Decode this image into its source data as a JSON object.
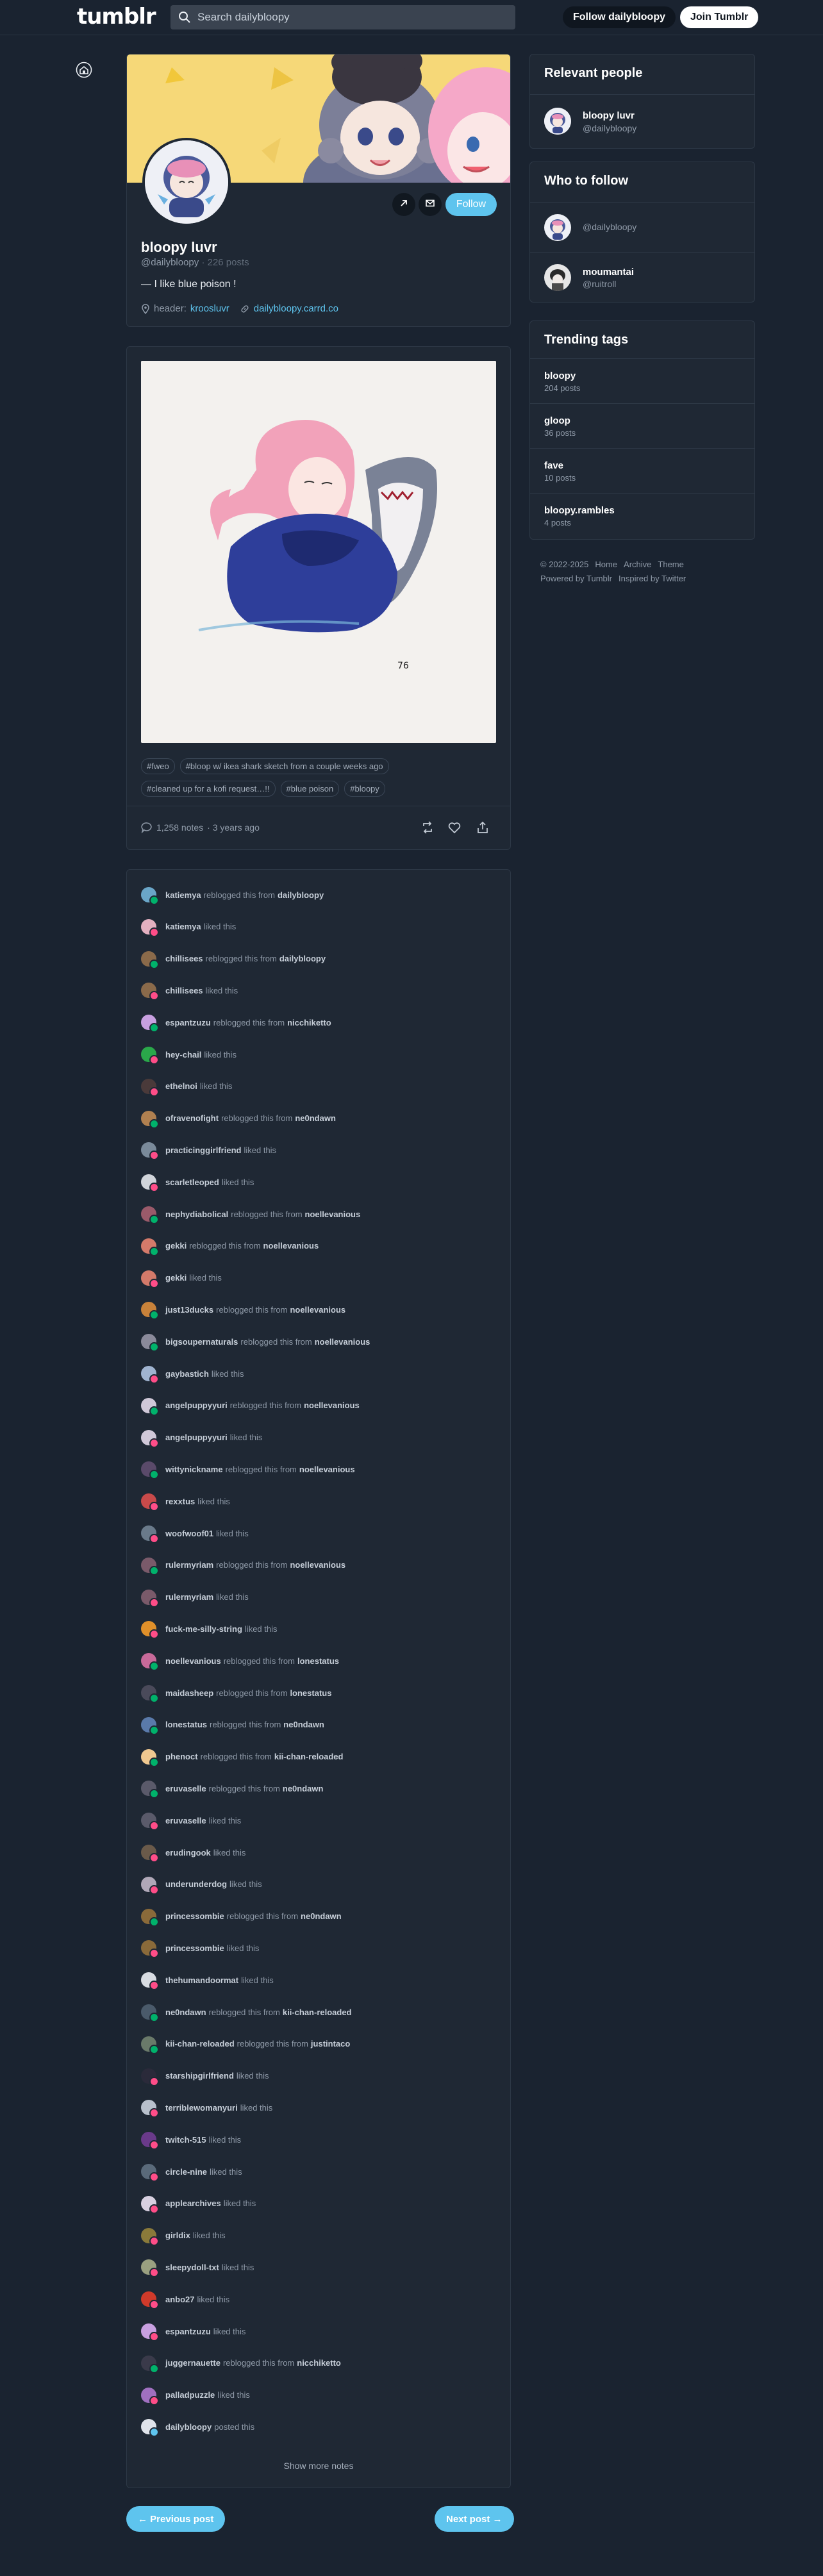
{
  "topbar": {
    "logo": "tumblr",
    "search_placeholder": "Search dailybloopy",
    "follow_blog": "Follow dailybloopy",
    "join": "Join Tumblr"
  },
  "profile": {
    "name": "bloopy luvr",
    "handle": "@dailybloopy",
    "posts": "· 226 posts",
    "bio": "— I like blue poison !",
    "header_label": "header:",
    "header_credit": "kroosluvr",
    "link": "dailybloopy.carrd.co",
    "follow": "Follow"
  },
  "post": {
    "signature": "76",
    "tags": [
      "#fweo",
      "#bloop w/ ikea shark sketch from a couple weeks ago",
      "#cleaned up for a kofi request…!!",
      "#blue poison",
      "#bloopy"
    ],
    "notes_count": "1,258 notes",
    "time_ago": "· 3 years ago"
  },
  "notes": [
    {
      "user": "katiemya",
      "action": "reblogged this from",
      "from": "dailybloopy",
      "type": "reblog",
      "color": "#6aa6c8"
    },
    {
      "user": "katiemya",
      "action": "liked this",
      "from": "",
      "type": "like",
      "color": "#e3b0c0"
    },
    {
      "user": "chillisees",
      "action": "reblogged this from",
      "from": "dailybloopy",
      "type": "reblog",
      "color": "#8a6a4a"
    },
    {
      "user": "chillisees",
      "action": "liked this",
      "from": "",
      "type": "like",
      "color": "#8a6a4a"
    },
    {
      "user": "espantzuzu",
      "action": "reblogged this from",
      "from": "nicchiketto",
      "type": "reblog",
      "color": "#c8a0e0"
    },
    {
      "user": "hey-chail",
      "action": "liked this",
      "from": "",
      "type": "like",
      "color": "#2aa84a"
    },
    {
      "user": "ethelnoi",
      "action": "liked this",
      "from": "",
      "type": "like",
      "color": "#4a3a3a"
    },
    {
      "user": "ofravenofight",
      "action": "reblogged this from",
      "from": "ne0ndawn",
      "type": "reblog",
      "color": "#b08050"
    },
    {
      "user": "practicinggirlfriend",
      "action": "liked this",
      "from": "",
      "type": "like",
      "color": "#7a8a9a"
    },
    {
      "user": "scarletleoped",
      "action": "liked this",
      "from": "",
      "type": "like",
      "color": "#d0d4da"
    },
    {
      "user": "nephydiabolical",
      "action": "reblogged this from",
      "from": "noellevanious",
      "type": "reblog",
      "color": "#9a5a6a"
    },
    {
      "user": "gekki",
      "action": "reblogged this from",
      "from": "noellevanious",
      "type": "reblog",
      "color": "#d47a6a"
    },
    {
      "user": "gekki",
      "action": "liked this",
      "from": "",
      "type": "like",
      "color": "#d47a6a"
    },
    {
      "user": "just13ducks",
      "action": "reblogged this from",
      "from": "noellevanious",
      "type": "reblog",
      "color": "#c8823a"
    },
    {
      "user": "bigsoupernaturals",
      "action": "reblogged this from",
      "from": "noellevanious",
      "type": "reblog",
      "color": "#8a8a9a"
    },
    {
      "user": "gaybastich",
      "action": "liked this",
      "from": "",
      "type": "like",
      "color": "#a0b4d0"
    },
    {
      "user": "angelpuppyyuri",
      "action": "reblogged this from",
      "from": "noellevanious",
      "type": "reblog",
      "color": "#d0c8d8"
    },
    {
      "user": "angelpuppyyuri",
      "action": "liked this",
      "from": "",
      "type": "like",
      "color": "#d0c8d8"
    },
    {
      "user": "wittynickname",
      "action": "reblogged this from",
      "from": "noellevanious",
      "type": "reblog",
      "color": "#5a4a6a"
    },
    {
      "user": "rexxtus",
      "action": "liked this",
      "from": "",
      "type": "like",
      "color": "#c84a4a"
    },
    {
      "user": "woofwoof01",
      "action": "liked this",
      "from": "",
      "type": "like",
      "color": "#6a7a8a"
    },
    {
      "user": "rulermyriam",
      "action": "reblogged this from",
      "from": "noellevanious",
      "type": "reblog",
      "color": "#7a5a6a"
    },
    {
      "user": "rulermyriam",
      "action": "liked this",
      "from": "",
      "type": "like",
      "color": "#7a5a6a"
    },
    {
      "user": "fuck-me-silly-string",
      "action": "liked this",
      "from": "",
      "type": "like",
      "color": "#e0902a"
    },
    {
      "user": "noellevanious",
      "action": "reblogged this from",
      "from": "lonestatus",
      "type": "reblog",
      "color": "#c86a9a"
    },
    {
      "user": "maidasheep",
      "action": "reblogged this from",
      "from": "lonestatus",
      "type": "reblog",
      "color": "#4a4a5a"
    },
    {
      "user": "lonestatus",
      "action": "reblogged this from",
      "from": "ne0ndawn",
      "type": "reblog",
      "color": "#5a7aaa"
    },
    {
      "user": "phenoct",
      "action": "reblogged this from",
      "from": "kii-chan-reloaded",
      "type": "reblog",
      "color": "#f0c890"
    },
    {
      "user": "eruvaselle",
      "action": "reblogged this from",
      "from": "ne0ndawn",
      "type": "reblog",
      "color": "#5a5a6a"
    },
    {
      "user": "eruvaselle",
      "action": "liked this",
      "from": "",
      "type": "like",
      "color": "#5a5a6a"
    },
    {
      "user": "erudingook",
      "action": "liked this",
      "from": "",
      "type": "like",
      "color": "#6a5a4a"
    },
    {
      "user": "underunderdog",
      "action": "liked this",
      "from": "",
      "type": "like",
      "color": "#b0a8b8"
    },
    {
      "user": "princessombie",
      "action": "reblogged this from",
      "from": "ne0ndawn",
      "type": "reblog",
      "color": "#8a6a3a"
    },
    {
      "user": "princessombie",
      "action": "liked this",
      "from": "",
      "type": "like",
      "color": "#8a6a3a"
    },
    {
      "user": "thehumandoormat",
      "action": "liked this",
      "from": "",
      "type": "like",
      "color": "#d8dce2"
    },
    {
      "user": "ne0ndawn",
      "action": "reblogged this from",
      "from": "kii-chan-reloaded",
      "type": "reblog",
      "color": "#4a5a6a"
    },
    {
      "user": "kii-chan-reloaded",
      "action": "reblogged this from",
      "from": "justintaco",
      "type": "reblog",
      "color": "#6a7a6a"
    },
    {
      "user": "starshipgirlfriend",
      "action": "liked this",
      "from": "",
      "type": "like",
      "color": "#2a2a3a"
    },
    {
      "user": "terriblewomanyuri",
      "action": "liked this",
      "from": "",
      "type": "like",
      "color": "#b8c0cc"
    },
    {
      "user": "twitch-515",
      "action": "liked this",
      "from": "",
      "type": "like",
      "color": "#6a3a8a"
    },
    {
      "user": "circle-nine",
      "action": "liked this",
      "from": "",
      "type": "like",
      "color": "#5a6a7a"
    },
    {
      "user": "applearchives",
      "action": "liked this",
      "from": "",
      "type": "like",
      "color": "#d8d0e0"
    },
    {
      "user": "girldix",
      "action": "liked this",
      "from": "",
      "type": "like",
      "color": "#8a7a3a"
    },
    {
      "user": "sleepydoll-txt",
      "action": "liked this",
      "from": "",
      "type": "like",
      "color": "#9aa080"
    },
    {
      "user": "anbo27",
      "action": "liked this",
      "from": "",
      "type": "like",
      "color": "#d03a2a"
    },
    {
      "user": "espantzuzu",
      "action": "liked this",
      "from": "",
      "type": "like",
      "color": "#c8a0e0"
    },
    {
      "user": "juggernauette",
      "action": "reblogged this from",
      "from": "nicchiketto",
      "type": "reblog",
      "color": "#3a3a4a"
    },
    {
      "user": "palladpuzzle",
      "action": "liked this",
      "from": "",
      "type": "like",
      "color": "#a070c0"
    },
    {
      "user": "dailybloopy",
      "action": "posted this",
      "from": "",
      "type": "post",
      "color": "#dfe3ea"
    }
  ],
  "show_more": "Show more notes",
  "nav": {
    "prev": "← Previous post",
    "next": "Next post →"
  },
  "relevant": {
    "title": "Relevant people",
    "people": [
      {
        "name": "bloopy luvr",
        "handle": "@dailybloopy"
      }
    ]
  },
  "who_to_follow": {
    "title": "Who to follow",
    "people": [
      {
        "name": "",
        "handle": "@dailybloopy"
      },
      {
        "name": "moumantai",
        "handle": "@ruitroll"
      }
    ]
  },
  "trending": {
    "title": "Trending tags",
    "tags": [
      {
        "name": "bloopy",
        "count": "204 posts"
      },
      {
        "name": "gloop",
        "count": "36 posts"
      },
      {
        "name": "fave",
        "count": "10 posts"
      },
      {
        "name": "bloopy.rambles",
        "count": "4 posts"
      }
    ]
  },
  "footer": {
    "copyright": "© 2022-2025",
    "home": "Home",
    "archive": "Archive",
    "theme": "Theme",
    "powered": "Powered by Tumblr",
    "inspired": "Inspired by Twitter"
  },
  "colors": {
    "accent": "#5ec4ee",
    "reblog_badge": "#00b26b",
    "like_badge": "#ff4d88",
    "post_badge": "#5ec4ee"
  }
}
